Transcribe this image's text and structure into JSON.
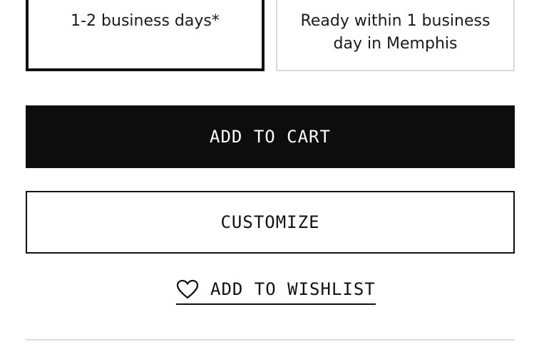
{
  "delivery_options": [
    {
      "text": "1-2 business days*",
      "selected": true
    },
    {
      "text": "Ready within 1 business day in Memphis",
      "selected": false
    }
  ],
  "actions": {
    "add_to_cart_label": "ADD TO CART",
    "customize_label": "CUSTOMIZE",
    "wishlist_label": "ADD TO WISHLIST",
    "wishlist_icon": "heart-icon"
  },
  "colors": {
    "primary_button_bg": "#0d0d0d",
    "primary_button_text": "#ffffff",
    "selected_border": "#111111",
    "unselected_border": "#d9d9d9"
  }
}
